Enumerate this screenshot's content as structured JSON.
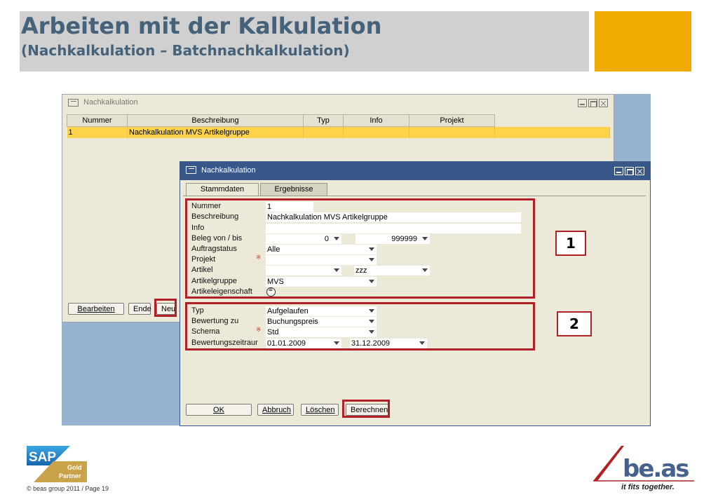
{
  "slide": {
    "title": "Arbeiten mit der Kalkulation",
    "subtitle": "(Nachkalkulation – Batchnachkalkulation)",
    "footer": "© beas group 2011 / Page 19",
    "colors": {
      "title": "#45627a",
      "accent": "#f0ab00",
      "header_bg": "#d0d0d0",
      "highlight_box": "#b21f24"
    },
    "logos": {
      "sap": {
        "text": "SAP",
        "line1": "Gold",
        "line2": "Partner"
      },
      "beas": {
        "text": "be.as",
        "tagline": "it fits together."
      }
    }
  },
  "list_window": {
    "title": "Nachkalkulation",
    "columns": [
      "Nummer",
      "Beschreibung",
      "Typ",
      "Info",
      "Projekt"
    ],
    "rows": [
      {
        "nummer": "1",
        "beschreibung": "Nachkalkulation MVS Artikelgruppe",
        "typ": "",
        "info": "",
        "projekt": ""
      }
    ],
    "buttons": {
      "bearbeiten": "Bearbeiten",
      "ende": "Ende",
      "neu": "Neu"
    }
  },
  "detail_window": {
    "title": "Nachkalkulation",
    "tabs": [
      "Stammdaten",
      "Ergebnisse"
    ],
    "group1": {
      "labels": {
        "nummer": "Nummer",
        "beschreibung": "Beschreibung",
        "info": "Info",
        "beleg": "Beleg von / bis",
        "auftragstatus": "Auftragstatus",
        "projekt": "Projekt",
        "artikel": "Artikel",
        "artikelgruppe": "Artikelgruppe",
        "artikeleigenschaft": "Artikeleigenschaft"
      },
      "values": {
        "nummer": "1",
        "beschreibung": "Nachkalkulation MVS Artikelgruppe",
        "info": "",
        "beleg_von": "0",
        "beleg_bis": "999999",
        "auftragstatus": "Alle",
        "projekt": "",
        "artikel_von": "",
        "artikel_bis": "zzz",
        "artikelgruppe": "MVS"
      },
      "required_mark": "※"
    },
    "group2": {
      "labels": {
        "typ": "Typ",
        "bewertung": "Bewertung zu",
        "schema": "Schema",
        "zeitraum": "Bewertungszeitraur"
      },
      "values": {
        "typ": "Aufgelaufen",
        "bewertung": "Buchungspreis",
        "schema": "Std",
        "von": "01.01.2009",
        "bis": "31.12.2009"
      },
      "required_mark": "※"
    },
    "buttons": {
      "ok": "OK",
      "abbruch": "Abbruch",
      "loeschen": "Löschen",
      "berechnen": "Berechnen"
    }
  },
  "callouts": [
    "1",
    "2"
  ]
}
